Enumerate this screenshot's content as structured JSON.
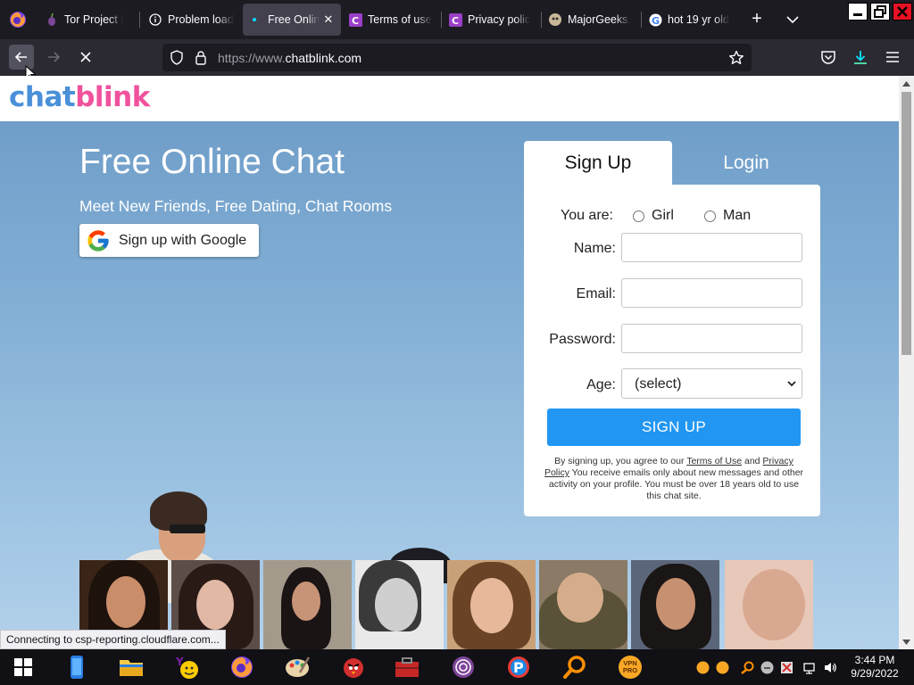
{
  "browser": {
    "tabs": [
      {
        "title": "Tor Project |",
        "active": false
      },
      {
        "title": "Problem load",
        "active": false
      },
      {
        "title": "Free Onlin",
        "active": true
      },
      {
        "title": "Terms of use",
        "active": false
      },
      {
        "title": "Privacy polic",
        "active": false
      },
      {
        "title": "MajorGeeks.",
        "active": false
      },
      {
        "title": "hot 19 yr old",
        "active": false
      }
    ],
    "new_tab_label": "+",
    "tab_close_glyph": "✕",
    "url_scheme": "https://www.",
    "url_host": "chatblink.com",
    "status_text": "Connecting to csp-reporting.cloudflare.com..."
  },
  "site": {
    "logo_part1": "chat",
    "logo_part2": "blink",
    "hero_title": "Free Online Chat",
    "hero_subtitle": "Meet New Friends, Free Dating, Chat Rooms",
    "google_button": "Sign up with Google",
    "tabs": {
      "signup": "Sign Up",
      "login": "Login"
    },
    "form": {
      "you_are_label": "You are:",
      "gender_options": [
        "Girl",
        "Man"
      ],
      "name_label": "Name:",
      "email_label": "Email:",
      "password_label": "Password:",
      "age_label": "Age:",
      "age_selected": "(select)",
      "submit_label": "SIGN UP"
    },
    "terms": {
      "prefix": "By signing up, you agree to our ",
      "terms_link": "Terms of Use",
      "and": " and ",
      "privacy_link": "Privacy Policy",
      "suffix": " You receive emails only about new messages and other activity on your profile. You must be over 18 years old to use this chat site."
    }
  },
  "taskbar": {
    "time": "3:44 PM",
    "date": "9/29/2022",
    "vpn_label": "VPN PRO"
  },
  "colors": {
    "accent_blue": "#2196f3",
    "logo_blue": "#4a90d9",
    "logo_pink": "#f0529c",
    "browser_dark": "#1c1b22",
    "toolbar": "#2b2a33"
  }
}
